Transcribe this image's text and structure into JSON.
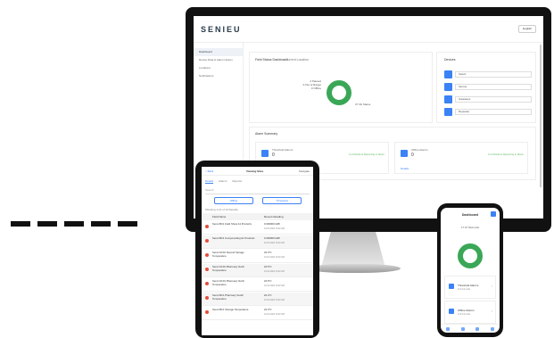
{
  "desktop": {
    "logo": "SENIEU",
    "language": "English",
    "sidebar": [
      {
        "label": "Dashboard",
        "active": true
      },
      {
        "label": "Device Data & Alarm History",
        "active": false
      },
      {
        "label": "Locations",
        "active": false
      },
      {
        "label": "Notifications",
        "active": false
      }
    ],
    "sidebar_footer": "Username",
    "field_status": {
      "title": "Field Status Dashboard",
      "location": "Current Location",
      "labels": [
        "2 Paused",
        "0 Out of Range",
        "0 Offline"
      ],
      "ok_label": "37 Ok Status",
      "donut_color": "#3aa757"
    },
    "devices": {
      "title": "Devices",
      "rows": [
        "Select",
        "Sensor",
        "Gateways",
        "Repeater"
      ]
    },
    "alarm_summary": {
      "title": "Alarm Summary",
      "boxes": [
        {
          "title": "Threshold Alarms",
          "count": "0",
          "badge": "0 of Monitors Reporting in Alarm",
          "link": "Details"
        },
        {
          "title": "Offline Alarms",
          "count": "0",
          "badge": "0 of Monitors Reporting in Alarm",
          "link": "Details"
        }
      ]
    },
    "accent_color": "#3b82f6"
  },
  "tablet": {
    "back": "< Back",
    "title": "Viewing Sites",
    "language": "Navigate",
    "tabs": [
      "Details",
      "Alarms",
      "Reports"
    ],
    "search_placeholder": "Search",
    "btn_offline": "Offline",
    "btn_threshold": "Threshold",
    "count_text": "Showing 1-14 of 14 Results",
    "col_name": "Field Name",
    "col_reading": "Recent Reading",
    "rows": [
      {
        "name": "Senvi-BC1 Field Show A1 Products",
        "reading": "0.000000 kWh",
        "time": "10.01.2023 10:42 AM"
      },
      {
        "name": "Senvi-BC1 Compounding A1 Products",
        "reading": "0.000000 kWh",
        "time": "10.01.2023 10:42 AM"
      },
      {
        "name": "Senvi-SC01 Second Storage Temperature",
        "reading": "23.3°C",
        "time": "10.01.2023 10:42 AM"
      },
      {
        "name": "Senvi-SC01 Pharmacy North Temperature",
        "reading": "23.5°C",
        "time": "10.01.2023 10:42 AM"
      },
      {
        "name": "Senvi-SC01 Pharmacy North Temperature",
        "reading": "23.5°C",
        "time": "10.01.2023 10:42 AM"
      },
      {
        "name": "Senvi-BC1 Pharmacy South Temperature",
        "reading": "22.2°C",
        "time": "10.01.2023 10:42 AM"
      },
      {
        "name": "Senvi-BC1 Storage Temperature",
        "reading": "24.3°C",
        "time": "10.01.2023 10:42 AM"
      }
    ]
  },
  "phone": {
    "title": "Dashboard",
    "subtitle": "17 Of Total units",
    "donut_color": "#3aa757",
    "cards": [
      {
        "title": "Threshold Alarms",
        "count": "0 of 14 units"
      },
      {
        "title": "Offline Alarms",
        "count": "0 of 14 units"
      }
    ]
  }
}
